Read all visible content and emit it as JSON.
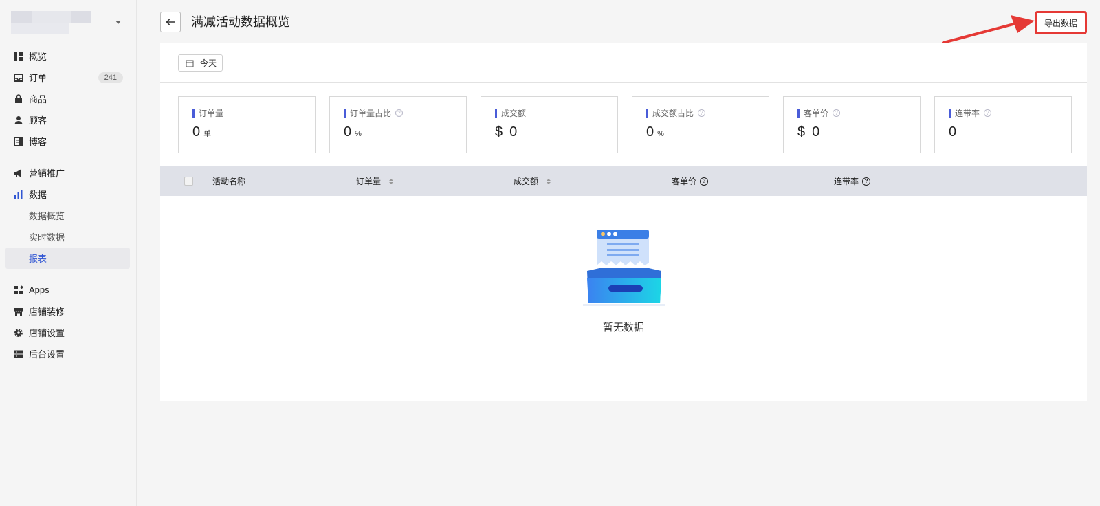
{
  "sidebar": {
    "items": [
      {
        "label": "概览",
        "icon": "overview-icon"
      },
      {
        "label": "订单",
        "icon": "order-icon",
        "badge": "241"
      },
      {
        "label": "商品",
        "icon": "product-icon"
      },
      {
        "label": "顾客",
        "icon": "customer-icon"
      },
      {
        "label": "博客",
        "icon": "blog-icon"
      },
      {
        "label": "营销推广",
        "icon": "megaphone-icon"
      },
      {
        "label": "数据",
        "icon": "data-chart-icon"
      },
      {
        "label": "数据概览",
        "sub": true
      },
      {
        "label": "实时数据",
        "sub": true
      },
      {
        "label": "报表",
        "sub": true,
        "active": true
      },
      {
        "label": "Apps",
        "icon": "apps-icon"
      },
      {
        "label": "店铺装修",
        "icon": "storefront-icon"
      },
      {
        "label": "店铺设置",
        "icon": "gear-icon"
      },
      {
        "label": "后台设置",
        "icon": "server-icon"
      }
    ]
  },
  "header": {
    "title": "满减活动数据概览",
    "export_label": "导出数据"
  },
  "filter": {
    "date_label": "今天"
  },
  "stats": [
    {
      "label": "订单量",
      "value": "0",
      "unit": "单",
      "help": false
    },
    {
      "label": "订单量占比",
      "value": "0",
      "unit": "%",
      "help": true
    },
    {
      "label": "成交额",
      "value": "0",
      "currency": "$",
      "help": false
    },
    {
      "label": "成交额占比",
      "value": "0",
      "unit": "%",
      "help": true
    },
    {
      "label": "客单价",
      "value": "0",
      "currency": "$",
      "help": true
    },
    {
      "label": "连带率",
      "value": "0",
      "help": true
    }
  ],
  "table": {
    "columns": {
      "name": "活动名称",
      "orders": "订单量",
      "sales": "成交额",
      "aov": "客单价",
      "attach_rate": "连带率"
    },
    "empty_text": "暂无数据"
  },
  "colors": {
    "accent": "#4a5cd8",
    "highlight": "#e53935",
    "table_header": "#dfe1e8"
  }
}
